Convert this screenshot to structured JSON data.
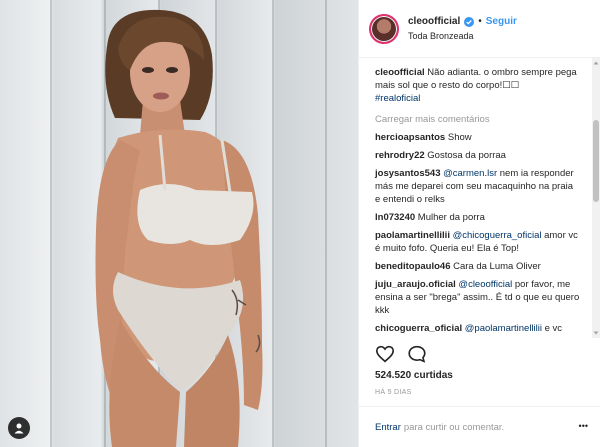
{
  "post": {
    "username": "cleoofficial",
    "follow_label": "Seguir",
    "separator": "•",
    "location": "Toda Bronzeada",
    "caption": {
      "user": "cleoofficial",
      "text": " Não adianta. o ombro sempre pega mais sol que o resto do corpo!",
      "emoji": "☐☐",
      "hashtag": "#realoficial"
    },
    "load_more": "Carregar mais comentários",
    "comments": [
      {
        "user": "hercioapsantos",
        "text": " Show"
      },
      {
        "user": "rehrodry22",
        "text": " Gostosa da porraa"
      },
      {
        "user": "josysantos543",
        "mention": " @carmen.lsr",
        "text": " nem ia responder más me deparei com seu macaquinho na praia e entendi o relks"
      },
      {
        "user": "ln073240",
        "text": " Mulher da porra"
      },
      {
        "user": "paolamartinellilii",
        "mention": " @chicoguerra_oficial",
        "text": " amor vc é muito fofo. Queria eu! Ela é Top!"
      },
      {
        "user": "beneditopaulo46",
        "text": " Cara da Luma Oliver"
      },
      {
        "user": "juju_araujo.oficial",
        "mention": " @cleoofficial",
        "text": " por favor, me ensina a ser \"brega\" assim.. É td o que eu quero kkk"
      },
      {
        "user": "chicoguerra_oficial",
        "mention": " @paolamartinellilii",
        "text": " e vc"
      }
    ],
    "likes": "524.520 curtidas",
    "time": "HÁ 5 DIAS",
    "login_label": "Entrar",
    "comment_prompt": "para curtir ou comentar.",
    "more_label": "•••"
  },
  "colors": {
    "accent": "#3897f0",
    "link": "#003569",
    "muted": "#999999"
  },
  "icons": {
    "verified": "verified-badge-icon",
    "like": "heart-icon",
    "comment": "speech-bubble-icon",
    "tag": "person-tag-icon",
    "more": "more-options-icon"
  }
}
